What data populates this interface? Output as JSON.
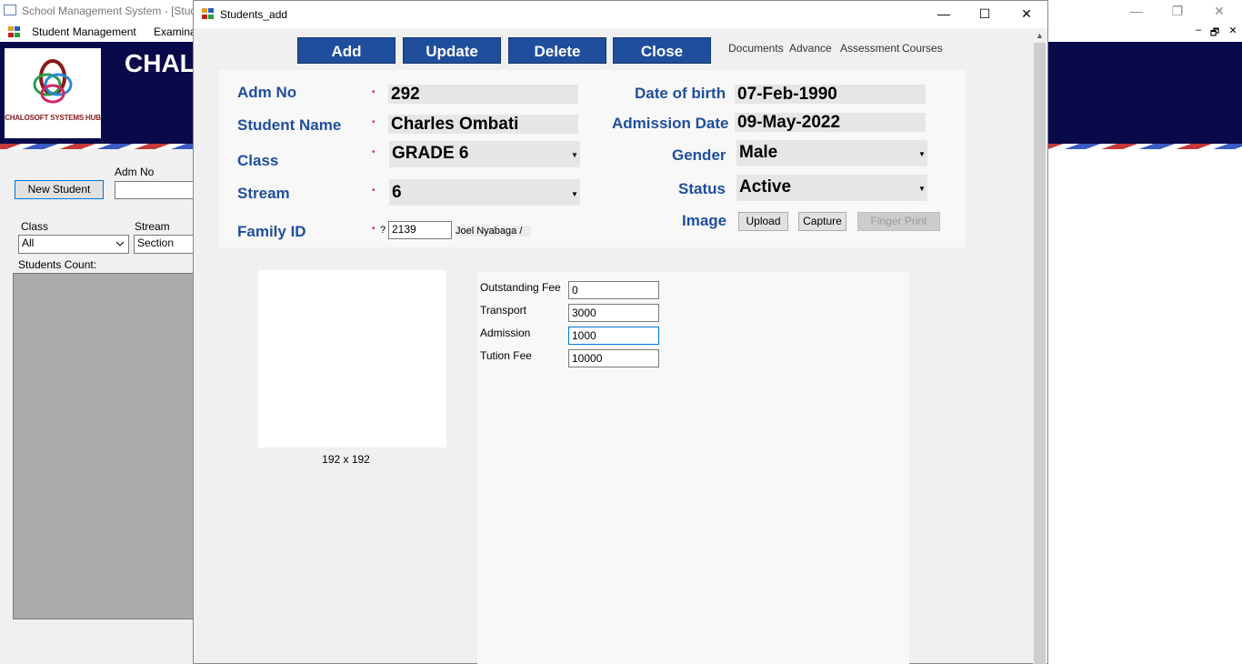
{
  "main_window": {
    "title": "School Management System - [Stud",
    "controls": {
      "minimize": "—",
      "restore": "❐",
      "close": "✕"
    },
    "menu": [
      {
        "label": "Student Management"
      },
      {
        "label": "Examina"
      }
    ],
    "mdi_controls": {
      "minimize": "–",
      "restore": "🗗",
      "close": "✕"
    },
    "banner": {
      "logo_text": "CHALOSOFT SYSTEMS HUB",
      "title": "CHAL"
    },
    "new_student_button": "New Student",
    "adm_no_label": "Adm No",
    "adm_no_value": "",
    "class_label": "Class",
    "class_value": "All",
    "stream_label": "Stream",
    "stream_value": "Section",
    "students_count_label": "Students Count:"
  },
  "dialog": {
    "title": "Students_add",
    "controls": {
      "minimize": "—",
      "maximize": "☐",
      "close": "✕"
    },
    "scroll_up": "▲",
    "toolbar": {
      "add": "Add",
      "update": "Update",
      "delete": "Delete",
      "close": "Close",
      "links": [
        "Documents",
        "Advance",
        "Assessment",
        "Courses"
      ]
    },
    "form": {
      "adm_no_label": "Adm No",
      "adm_no_value": "292",
      "student_name_label": "Student Name",
      "student_name_value": "Charles Ombati",
      "class_label": "Class",
      "class_value": "GRADE 6",
      "stream_label": "Stream",
      "stream_value": "6",
      "family_id_label": "Family ID",
      "family_id_value": "2139",
      "family_hint": "?",
      "family_name": "Joel Nyabaga /",
      "dob_label": "Date of birth",
      "dob_value": "07-Feb-1990",
      "admission_date_label": "Admission Date",
      "admission_date_value": "09-May-2022",
      "gender_label": "Gender",
      "gender_value": "Male",
      "status_label": "Status",
      "status_value": "Active",
      "image_label": "Image",
      "required_mark": "•",
      "dropdown_arrow": "▼",
      "upload_button": "Upload",
      "capture_button": "Capture",
      "finger_print_button": "Finger Print"
    },
    "photo": {
      "size_label": "192 x 192"
    },
    "fees": [
      {
        "label": "Outstanding Fee",
        "value": "0"
      },
      {
        "label": "Transport",
        "value": "3000"
      },
      {
        "label": "Admission",
        "value": "1000"
      },
      {
        "label": "Tution Fee",
        "value": "10000"
      }
    ],
    "colors": {
      "accent": "#1f4e9c",
      "banner": "#0a0a4a",
      "required": "#e03030"
    }
  }
}
